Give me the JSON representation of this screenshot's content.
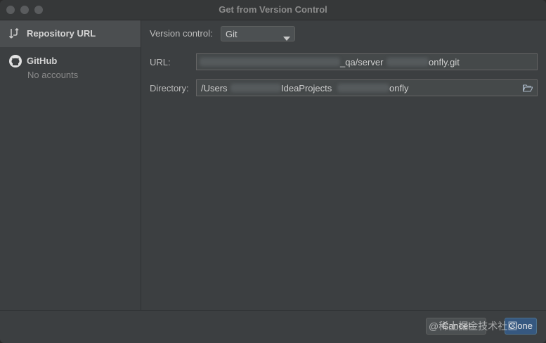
{
  "window": {
    "title": "Get from Version Control"
  },
  "sidebar": {
    "items": [
      {
        "label": "Repository URL",
        "icon": "vcs-branch-icon",
        "selected": true
      },
      {
        "label": "GitHub",
        "icon": "github-icon",
        "subtext": "No accounts"
      }
    ]
  },
  "form": {
    "version_control_label": "Version control:",
    "version_control_value": "Git",
    "url_label": "URL:",
    "url_value": "qa/server onfly.git",
    "url_parts": [
      "_qa/server",
      "onfly.git"
    ],
    "directory_label": "Directory:",
    "directory_parts": [
      "/Users",
      "IdeaProjects",
      "onfly"
    ]
  },
  "buttons": {
    "cancel": "Cancel",
    "clone": "Clone"
  },
  "watermark": "@稀土掘金技术社区",
  "colors": {
    "accent": "#365880",
    "background": "#3c3f41",
    "field": "#45494a"
  }
}
